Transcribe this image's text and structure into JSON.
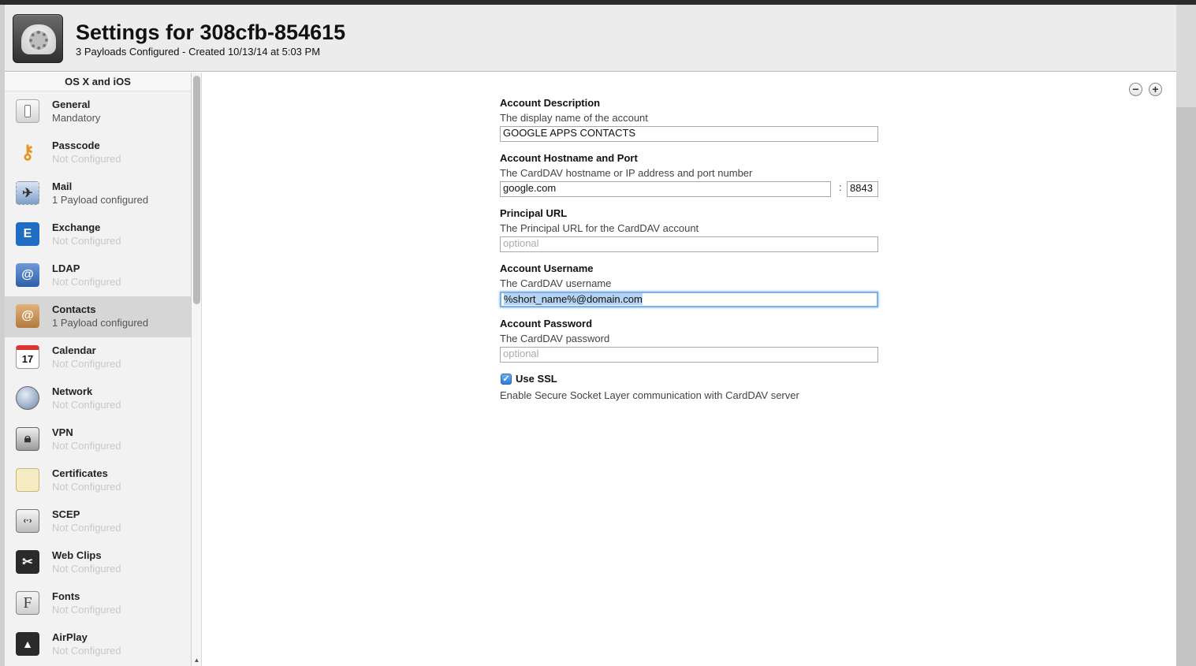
{
  "header": {
    "title": "Settings for 308cfb-854615",
    "subtitle": "3 Payloads Configured - Created 10/13/14 at 5:03 PM"
  },
  "sidebar": {
    "heading": "OS X and iOS",
    "items": [
      {
        "label": "General",
        "status": "Mandatory",
        "icon": "switch-icon",
        "configured": true
      },
      {
        "label": "Passcode",
        "status": "Not Configured",
        "icon": "key-icon",
        "configured": false
      },
      {
        "label": "Mail",
        "status": "1 Payload configured",
        "icon": "mail-stamp-icon",
        "configured": true
      },
      {
        "label": "Exchange",
        "status": "Not Configured",
        "icon": "exchange-icon",
        "configured": false
      },
      {
        "label": "LDAP",
        "status": "Not Configured",
        "icon": "address-book-icon",
        "configured": false
      },
      {
        "label": "Contacts",
        "status": "1 Payload configured",
        "icon": "contacts-icon",
        "configured": true,
        "selected": true
      },
      {
        "label": "Calendar",
        "status": "Not Configured",
        "icon": "calendar-icon",
        "configured": false,
        "icon_text": "17"
      },
      {
        "label": "Network",
        "status": "Not Configured",
        "icon": "globe-icon",
        "configured": false
      },
      {
        "label": "VPN",
        "status": "Not Configured",
        "icon": "lock-icon",
        "configured": false
      },
      {
        "label": "Certificates",
        "status": "Not Configured",
        "icon": "certificate-icon",
        "configured": false
      },
      {
        "label": "SCEP",
        "status": "Not Configured",
        "icon": "scep-lock-icon",
        "configured": false
      },
      {
        "label": "Web Clips",
        "status": "Not Configured",
        "icon": "scissors-icon",
        "configured": false
      },
      {
        "label": "Fonts",
        "status": "Not Configured",
        "icon": "font-icon",
        "configured": false,
        "icon_text": "F"
      },
      {
        "label": "AirPlay",
        "status": "Not Configured",
        "icon": "airplay-icon",
        "configured": false
      }
    ]
  },
  "toolbar": {
    "remove_label": "−",
    "add_label": "+"
  },
  "form": {
    "account_description": {
      "label": "Account Description",
      "help": "The display name of the account",
      "value": "GOOGLE APPS CONTACTS"
    },
    "hostname_port": {
      "label": "Account Hostname and Port",
      "help": "The CardDAV hostname or IP address and port number",
      "host_value": "google.com",
      "separator": ":",
      "port_value": "8843"
    },
    "principal_url": {
      "label": "Principal URL",
      "help": "The Principal URL for the CardDAV account",
      "placeholder": "optional"
    },
    "username": {
      "label": "Account Username",
      "help": "The CardDAV username",
      "value": "%short_name%@domain.com"
    },
    "password": {
      "label": "Account Password",
      "help": "The CardDAV password",
      "placeholder": "optional"
    },
    "ssl": {
      "label": "Use SSL",
      "checked": true,
      "help": "Enable Secure Socket Layer communication with CardDAV server"
    }
  }
}
